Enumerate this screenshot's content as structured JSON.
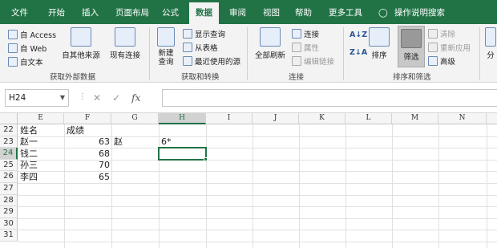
{
  "tabs": [
    "文件",
    "开始",
    "插入",
    "页面布局",
    "公式",
    "数据",
    "审阅",
    "视图",
    "帮助",
    "更多工具",
    "操作说明搜索"
  ],
  "active_tab": "数据",
  "ribbon": {
    "group1": {
      "items": [
        "自 Access",
        "自 Web",
        "自文本"
      ],
      "other_sources": "自其他来源",
      "existing_conn": "现有连接",
      "label": "获取外部数据"
    },
    "group2": {
      "new_query": "新建\n查询",
      "items": [
        "显示查询",
        "从表格",
        "最近使用的源"
      ],
      "label": "获取和转换"
    },
    "group3": {
      "refresh_all": "全部刷新",
      "items": [
        "连接",
        "属性",
        "编辑链接"
      ],
      "label": "连接"
    },
    "group4": {
      "sort": "排序",
      "filter": "筛选",
      "items": [
        "清除",
        "重新应用",
        "高级"
      ],
      "label": "排序和筛选"
    },
    "group5": {
      "partial": "分"
    }
  },
  "formula_bar": {
    "name_box": "H24",
    "fx": "fx",
    "formula": ""
  },
  "columns": [
    "E",
    "F",
    "G",
    "H",
    "I",
    "J",
    "K",
    "L",
    "M",
    "N"
  ],
  "selected_column": "H",
  "rows": [
    "22",
    "23",
    "24",
    "25",
    "26",
    "27",
    "28",
    "29",
    "30",
    "31"
  ],
  "selected_row": "24",
  "cells": {
    "E22": "姓名",
    "F22": "成绩",
    "E23": "赵一",
    "F23": "63",
    "G23": "赵",
    "H23": "6*",
    "E24": "钱二",
    "F24": "68",
    "E25": "孙三",
    "F25": "70",
    "E26": "李四",
    "F26": "65"
  }
}
